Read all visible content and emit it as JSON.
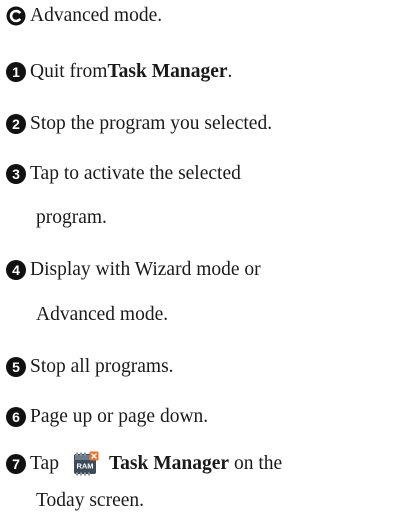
{
  "items": [
    {
      "marker": "C",
      "text": "Advanced mode."
    },
    {
      "marker": "1",
      "pre": "Quit from ",
      "bold": "Task Manager",
      "post": "."
    },
    {
      "marker": "2",
      "text": "Stop the program you selected."
    },
    {
      "marker": "3",
      "text": "Tap to activate the selected",
      "cont": "program."
    },
    {
      "marker": "4",
      "text": "Display with Wizard mode or",
      "cont": "Advanced mode."
    },
    {
      "marker": "5",
      "text": "Stop all programs."
    },
    {
      "marker": "6",
      "text": "Page up or page down."
    },
    {
      "marker": "7",
      "pre": "Tap",
      "bold": "Task Manager",
      "post": " on the",
      "cont": "Today screen.",
      "icon": "ram-task-manager-icon",
      "icon_text": "RAM"
    }
  ]
}
